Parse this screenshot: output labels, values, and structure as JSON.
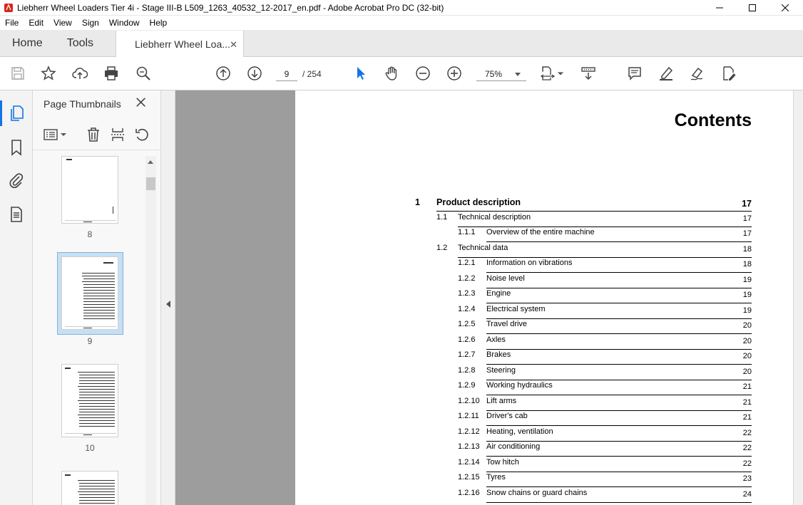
{
  "window": {
    "title": "Liebherr Wheel Loaders Tier 4i - Stage III-B L509_1263_40532_12-2017_en.pdf - Adobe Acrobat Pro DC (32-bit)"
  },
  "menu": [
    "File",
    "Edit",
    "View",
    "Sign",
    "Window",
    "Help"
  ],
  "tabs": {
    "home": "Home",
    "tools": "Tools",
    "document": "Liebherr Wheel Loa..."
  },
  "toolbar": {
    "current_page": "9",
    "total_pages": "/ 254",
    "zoom": "75%"
  },
  "panel": {
    "title": "Page Thumbnails",
    "thumbnails": [
      {
        "label": "8"
      },
      {
        "label": "9",
        "selected": true
      },
      {
        "label": "10"
      }
    ]
  },
  "document": {
    "heading": "Contents",
    "toc": [
      {
        "level": 1,
        "num": "1",
        "title": "Product description",
        "page": "17"
      },
      {
        "level": 2,
        "num": "1.1",
        "title": "Technical description",
        "page": "17"
      },
      {
        "level": 3,
        "num": "1.1.1",
        "title": "Overview of the entire machine",
        "page": "17"
      },
      {
        "level": 2,
        "num": "1.2",
        "title": "Technical data",
        "page": "18"
      },
      {
        "level": 3,
        "num": "1.2.1",
        "title": "Information on vibrations",
        "page": "18"
      },
      {
        "level": 3,
        "num": "1.2.2",
        "title": "Noise level",
        "page": "19"
      },
      {
        "level": 3,
        "num": "1.2.3",
        "title": "Engine",
        "page": "19"
      },
      {
        "level": 3,
        "num": "1.2.4",
        "title": "Electrical system",
        "page": "19"
      },
      {
        "level": 3,
        "num": "1.2.5",
        "title": "Travel drive",
        "page": "20"
      },
      {
        "level": 3,
        "num": "1.2.6",
        "title": "Axles",
        "page": "20"
      },
      {
        "level": 3,
        "num": "1.2.7",
        "title": "Brakes",
        "page": "20"
      },
      {
        "level": 3,
        "num": "1.2.8",
        "title": "Steering",
        "page": "20"
      },
      {
        "level": 3,
        "num": "1.2.9",
        "title": "Working hydraulics",
        "page": "21"
      },
      {
        "level": 3,
        "num": "1.2.10",
        "title": "Lift arms",
        "page": "21"
      },
      {
        "level": 3,
        "num": "1.2.11",
        "title": "Driver's cab",
        "page": "21"
      },
      {
        "level": 3,
        "num": "1.2.12",
        "title": "Heating, ventilation",
        "page": "22"
      },
      {
        "level": 3,
        "num": "1.2.13",
        "title": "Air conditioning",
        "page": "22"
      },
      {
        "level": 3,
        "num": "1.2.14",
        "title": "Tow hitch",
        "page": "22"
      },
      {
        "level": 3,
        "num": "1.2.15",
        "title": "Tyres",
        "page": "23"
      },
      {
        "level": 3,
        "num": "1.2.16",
        "title": "Snow chains or guard chains",
        "page": "24"
      }
    ]
  },
  "colors": {
    "accent": "#1473e6",
    "selection": "#c7dff3",
    "viewer_bg": "#9d9d9d"
  }
}
